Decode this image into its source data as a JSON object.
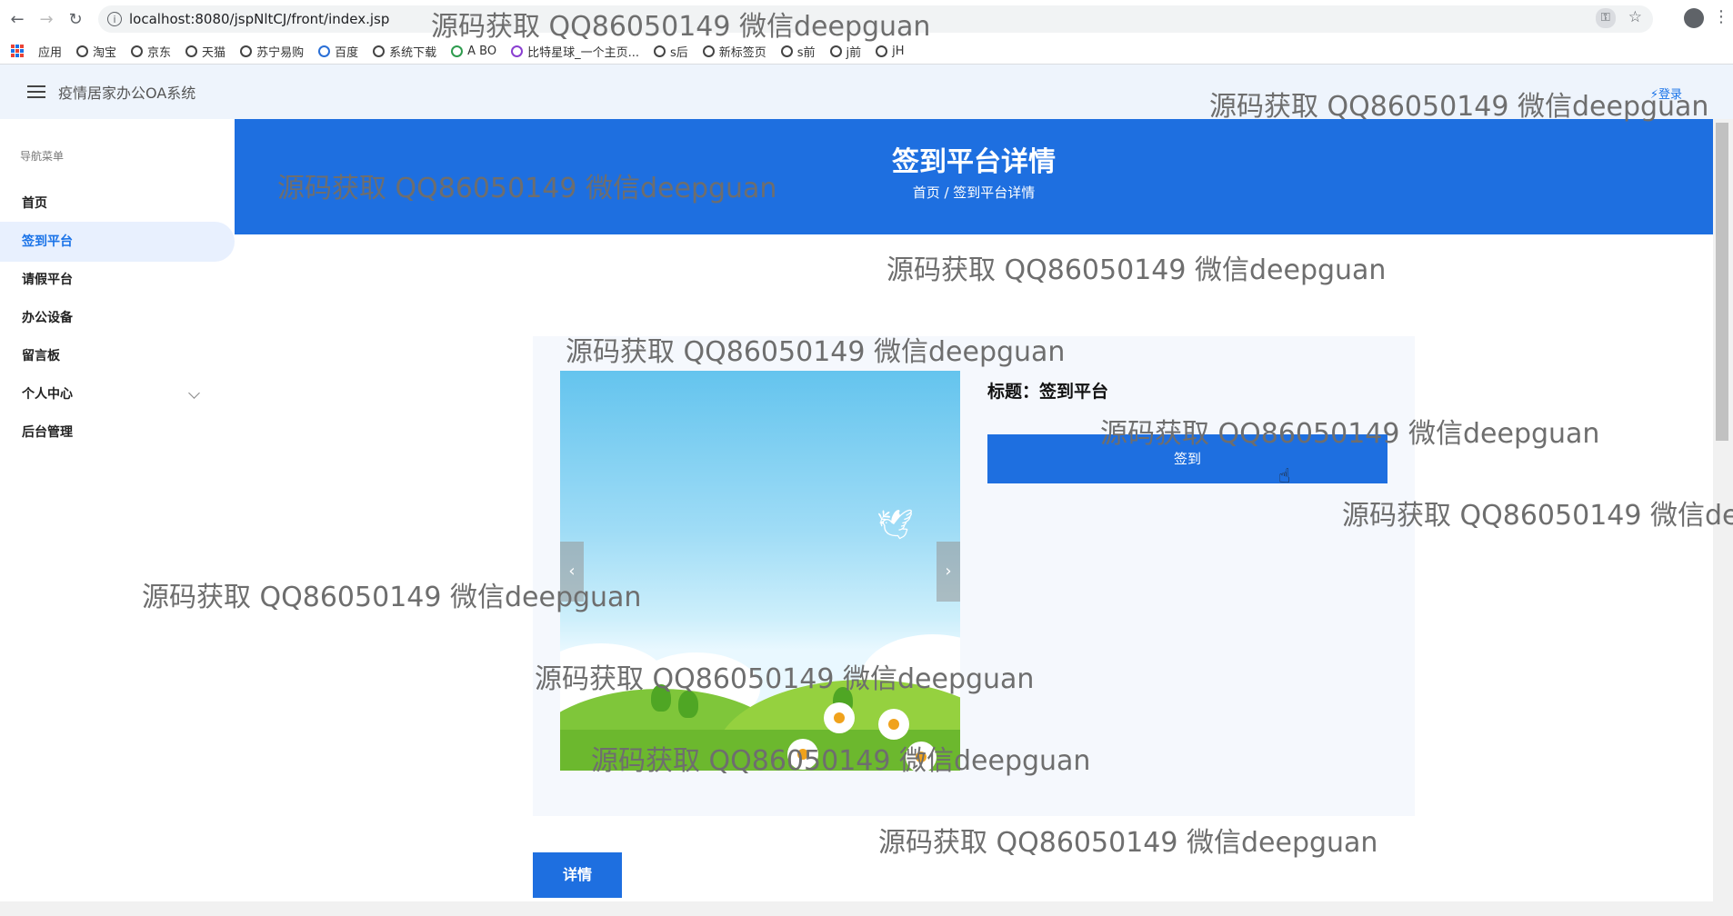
{
  "browser": {
    "url": "localhost:8080/jspNltCJ/front/index.jsp",
    "bookmarks": [
      "应用",
      "淘宝",
      "京东",
      "天猫",
      "苏宁易购",
      "百度",
      "系统下载",
      "A BO",
      "比特星球_一个主页...",
      "s后",
      "新标签页",
      "s前",
      "j前",
      "jH"
    ]
  },
  "header": {
    "app_title": "疫情居家办公OA系统",
    "login_label": "登录"
  },
  "sidebar": {
    "heading": "导航菜单",
    "items": [
      {
        "label": "首页"
      },
      {
        "label": "签到平台"
      },
      {
        "label": "请假平台"
      },
      {
        "label": "办公设备"
      },
      {
        "label": "留言板"
      },
      {
        "label": "个人中心"
      },
      {
        "label": "后台管理"
      }
    ],
    "active_index": 1
  },
  "banner": {
    "title": "签到平台详情",
    "breadcrumb": "首页 / 签到平台详情"
  },
  "detail": {
    "title_text": "标题：签到平台",
    "signin_label": "签到",
    "prev_label": "‹",
    "next_label": "›",
    "details_label": "详情"
  },
  "watermark": "源码获取 QQ86050149 微信deepguan",
  "colors": {
    "primary": "#1e6fe0",
    "header_bg": "#eef4fc",
    "card_bg": "#f5f8fd"
  }
}
